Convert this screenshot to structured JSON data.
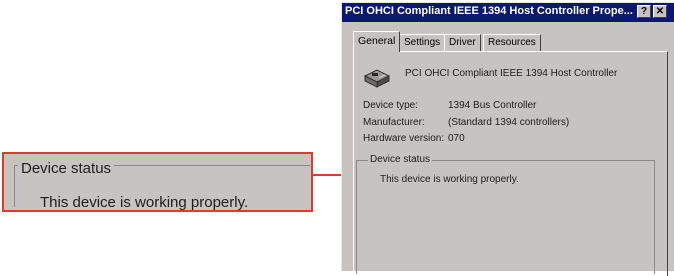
{
  "callout": {
    "legend": "Device status",
    "text": "This device is working properly."
  },
  "window": {
    "title": "PCI OHCI Compliant IEEE 1394 Host Controller Prope...",
    "help_button": "?",
    "close_button": "✕"
  },
  "tabs": [
    "General",
    "Settings",
    "Driver",
    "Resources"
  ],
  "device": {
    "icon": "network-card-icon",
    "name": "PCI OHCI Compliant IEEE 1394 Host Controller"
  },
  "properties": {
    "device_type_label": "Device type:",
    "device_type_value": "1394 Bus Controller",
    "manufacturer_label": "Manufacturer:",
    "manufacturer_value": "(Standard 1394 controllers)",
    "hardware_version_label": "Hardware version:",
    "hardware_version_value": "070"
  },
  "status": {
    "legend": "Device status",
    "text": "This device is working properly."
  },
  "colors": {
    "highlight": "#e03a2f",
    "titlebar": "#0a1870",
    "dialog_bg": "#c6c3c0"
  }
}
